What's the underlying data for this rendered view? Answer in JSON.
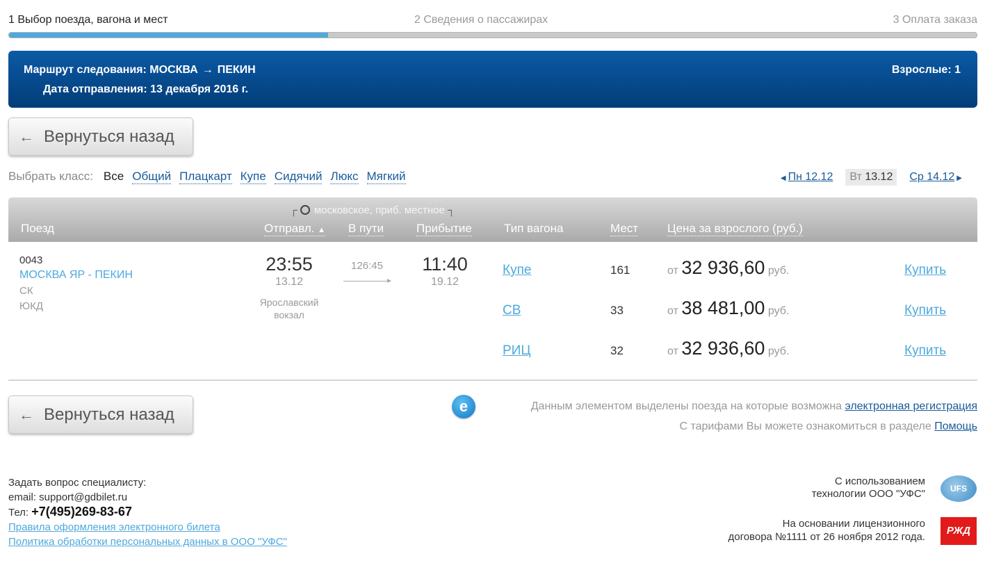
{
  "steps": {
    "step1": "1 Выбор поезда, вагона и мест",
    "step2": "2 Сведения о пассажирах",
    "step3": "3 Оплата заказа",
    "progress_fraction": 0.33
  },
  "banner": {
    "route_label": "Маршрут следования: МОСКВА",
    "route_to": "ПЕКИН",
    "date": "Дата отправления: 13 декабря 2016 г.",
    "adults": "Взрослые: 1"
  },
  "back_button": {
    "label": "Вернуться назад"
  },
  "class_filter": {
    "label": "Выбрать класс:",
    "options": [
      "Все",
      "Общий",
      "Плацкарт",
      "Купе",
      "Сидячий",
      "Люкс",
      "Мягкий"
    ]
  },
  "date_nav": {
    "prev": "Пн 12.12",
    "current_dow": "Вт",
    "current_date": "13.12",
    "next": "Ср 14.12"
  },
  "table_header": {
    "timezone": "московское, приб. местное",
    "train": "Поезд",
    "departure": "Отправл.",
    "travel": "В пути",
    "arrival": "Прибытие",
    "car_type": "Тип вагона",
    "seats": "Мест",
    "price": "Цена за взрослого (руб.)"
  },
  "train": {
    "number": "0043",
    "route": "МОСКВА ЯР - ПЕКИН",
    "category": "СК",
    "railway": "ЮКД",
    "dep_time": "23:55",
    "dep_date": "13.12",
    "dep_station_1": "Ярославский",
    "dep_station_2": "вокзал",
    "travel_time": "126:45",
    "arr_time": "11:40",
    "arr_date": "19.12",
    "cars": [
      {
        "type": "Купе",
        "seats": "161",
        "price_from": "от",
        "price": "32 936,60",
        "currency": "руб.",
        "buy": "Купить"
      },
      {
        "type": "СВ",
        "seats": "33",
        "price_from": "от",
        "price": "38 481,00",
        "currency": "руб.",
        "buy": "Купить"
      },
      {
        "type": "РИЦ",
        "seats": "32",
        "price_from": "от",
        "price": "32 936,60",
        "currency": "руб.",
        "buy": "Купить"
      }
    ]
  },
  "notes": {
    "e_icon_letter": "e",
    "ereg_text": "Данным элементом выделены поезда на которые возможна",
    "ereg_link": "электронная регистрация",
    "tariff_text": "С тарифами Вы можете ознакомиться в разделе",
    "tariff_link": "Помощь"
  },
  "footer": {
    "ask": "Задать вопрос специалисту:",
    "email": "email: support@gdbilet.ru",
    "phone_label": "Тел:",
    "phone": "+7(495)269-83-67",
    "link_rules": "Правила оформления электронного билета",
    "link_policy": "Политика обработки персональных данных в ООО \"УФС\"",
    "ufs_line1": "С использованием",
    "ufs_line2": "технологии ООО \"УФС\"",
    "ufs_logo": "UFS",
    "license_line1": "На основании лицензионного",
    "license_line2": "договора №1111 от 26 ноября 2012 года.",
    "rzd_logo": "РЖД"
  },
  "colors": {
    "banner": "#0b5aa6",
    "link": "#4ea9dc",
    "progress": "#4ea9dc",
    "rzd": "#e21a1a"
  }
}
